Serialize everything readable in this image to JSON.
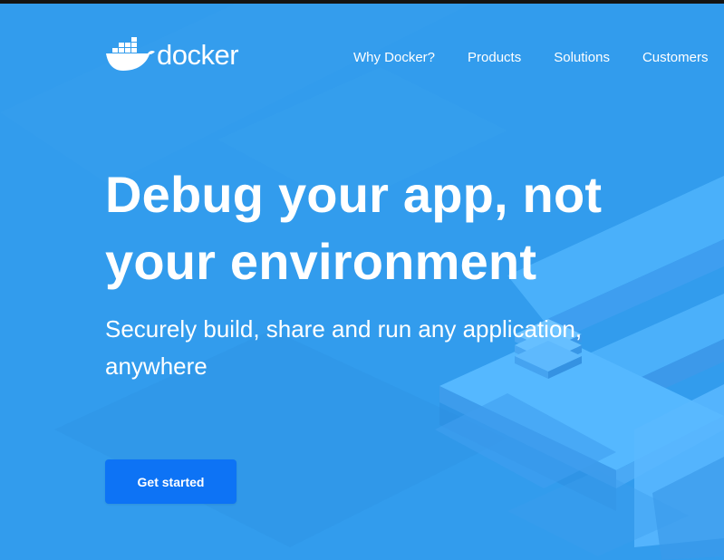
{
  "brand": {
    "name": "docker",
    "logo_icon": "docker-whale-icon"
  },
  "nav": {
    "items": [
      {
        "label": "Why Docker?"
      },
      {
        "label": "Products"
      },
      {
        "label": "Solutions"
      },
      {
        "label": "Customers"
      }
    ]
  },
  "hero": {
    "headline_line1": "Debug your app, not",
    "headline_line2": "your environment",
    "subheadline": "Securely build, share and run any application, anywhere",
    "cta_label": "Get started"
  },
  "colors": {
    "background": "#329ced",
    "button": "#0d73f5",
    "text": "#ffffff",
    "topbar": "#141414"
  }
}
